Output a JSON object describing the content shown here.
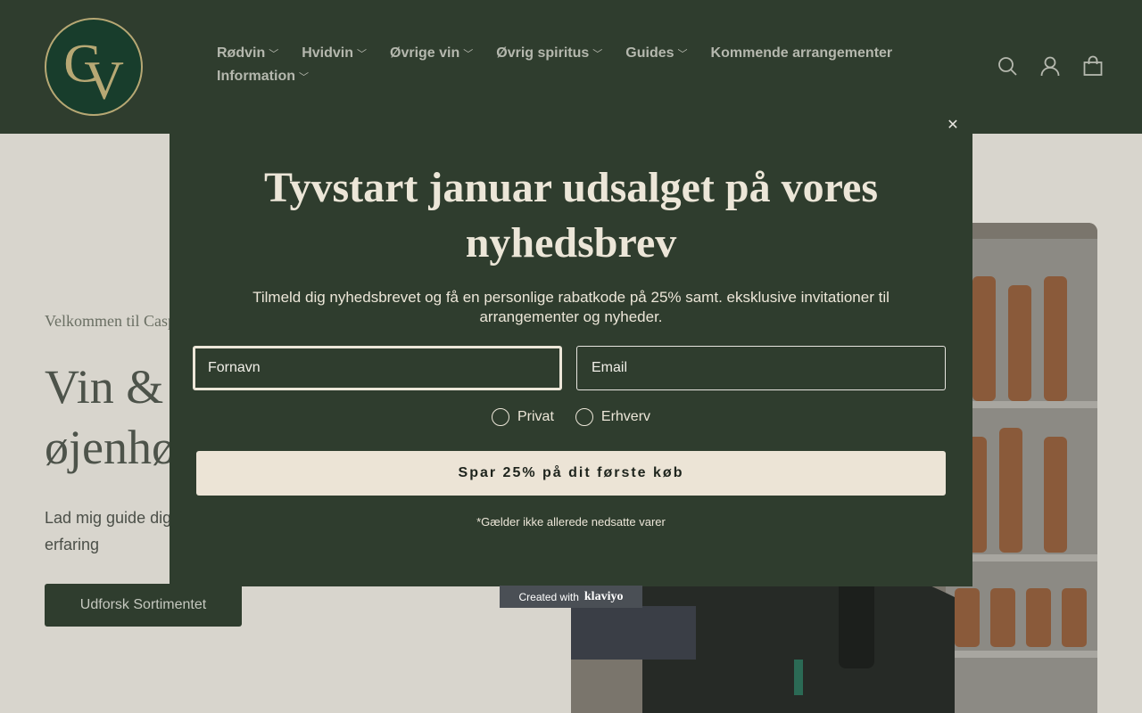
{
  "header": {
    "logo_letters": "CV",
    "nav": [
      {
        "label": "Rødvin",
        "dropdown": true
      },
      {
        "label": "Hvidvin",
        "dropdown": true
      },
      {
        "label": "Øvrige vin",
        "dropdown": true
      },
      {
        "label": "Øvrig spiritus",
        "dropdown": true
      },
      {
        "label": "Guides",
        "dropdown": true
      },
      {
        "label": "Kommende arrangementer",
        "dropdown": false
      },
      {
        "label": "Information",
        "dropdown": true
      }
    ],
    "icons": [
      "search-icon",
      "account-icon",
      "cart-icon"
    ]
  },
  "hero": {
    "kicker": "Velkommen til Casp",
    "title": "Vin & øjenhø",
    "text": "Lad mig guide dig erfaring",
    "button": "Udforsk Sortimentet"
  },
  "modal": {
    "title": "Tyvstart januar udsalget på vores nyhedsbrev",
    "subtitle": "Tilmeld dig nyhedsbrevet og få en personlige rabatkode på 25% samt. eksklusive invitationer til arrangementer og nyheder.",
    "first_name_placeholder": "Fornavn",
    "email_placeholder": "Email",
    "radio_private": "Privat",
    "radio_business": "Erhverv",
    "cta": "Spar 25% på dit første køb",
    "fine_print": "*Gælder ikke allerede nedsatte varer"
  },
  "klaviyo": {
    "label": "Created with",
    "brand": "klaviyo"
  },
  "colors": {
    "header_bg": "#2f3d2e",
    "modal_bg": "#2f3d2e",
    "cta_bg": "#ece4d6",
    "cream_text": "#ece6d8"
  }
}
